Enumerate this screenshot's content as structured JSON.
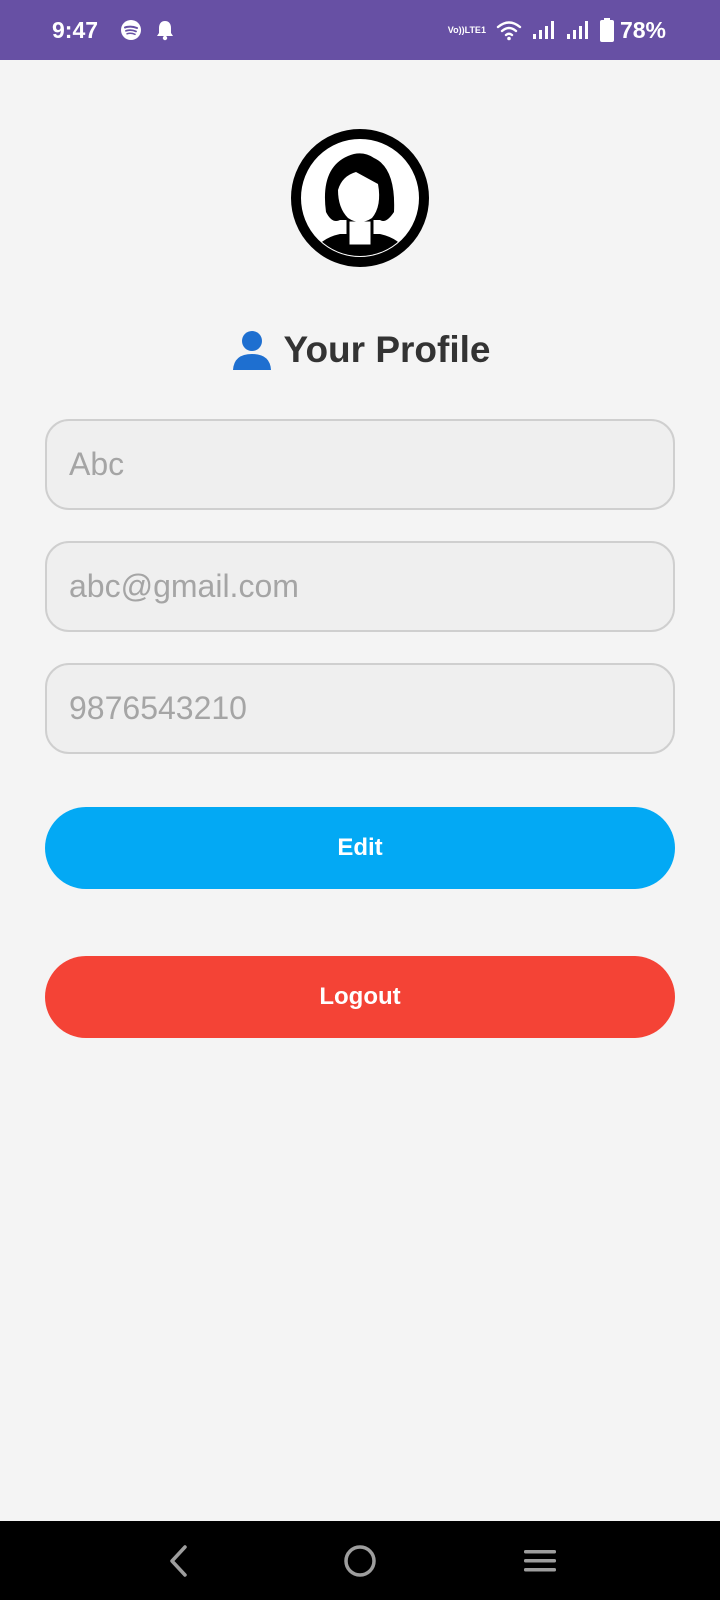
{
  "status_bar": {
    "time": "9:47",
    "battery": "78%",
    "volte_top": "Vo))",
    "volte_bottom": "LTE1",
    "icons": [
      "spotify-icon",
      "notification-bell-icon",
      "volte-icon",
      "wifi-icon",
      "signal-icon",
      "signal-icon",
      "battery-icon"
    ]
  },
  "profile": {
    "title_icon": "person-icon",
    "title": "Your Profile",
    "avatar_icon": "user-avatar-icon"
  },
  "form": {
    "name_placeholder": "Abc",
    "email_placeholder": "abc@gmail.com",
    "phone_placeholder": "9876543210"
  },
  "buttons": {
    "edit_label": "Edit",
    "logout_label": "Logout"
  },
  "colors": {
    "status_bar": "#6750a4",
    "edit": "#03a9f4",
    "logout": "#f44336",
    "background": "#f4f4f4"
  },
  "nav_bar": {
    "icons": [
      "back-icon",
      "home-icon",
      "recents-icon"
    ]
  }
}
